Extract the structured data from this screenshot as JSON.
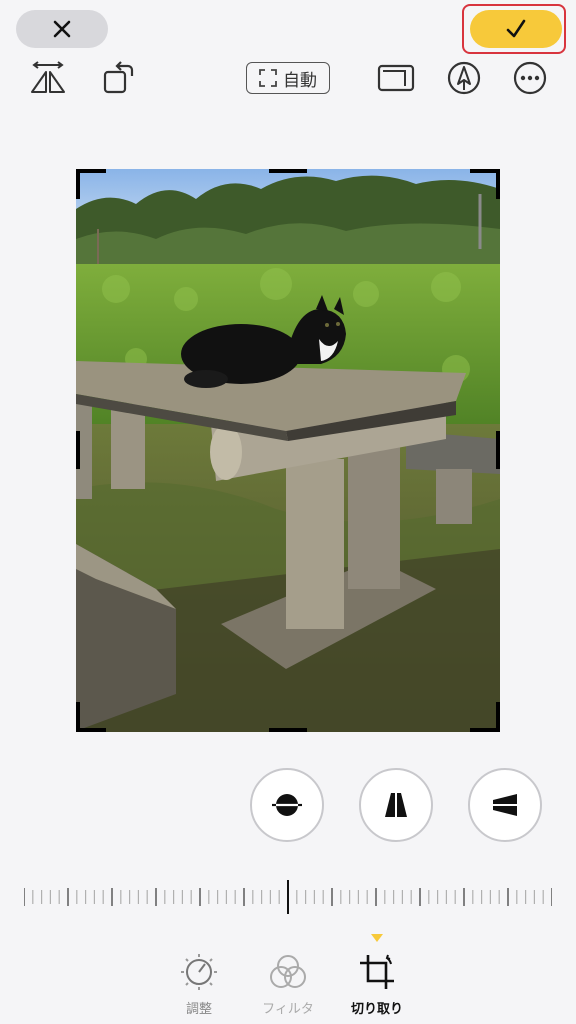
{
  "topbar": {
    "cancel_icon": "close-icon",
    "done_icon": "checkmark-icon",
    "auto_label": "自動"
  },
  "tools": {
    "flip": "flip-horizontal-icon",
    "rotate": "rotate-icon",
    "aspect": "aspect-ratio-icon",
    "markup": "markup-pen-icon",
    "more": "more-icon"
  },
  "adjust_tools": [
    "straighten-icon",
    "vertical-perspective-icon",
    "horizontal-perspective-icon"
  ],
  "tabs": [
    {
      "label": "調整",
      "icon": "adjust-dial-icon",
      "active": false
    },
    {
      "label": "フィルタ",
      "icon": "filters-icon",
      "active": false
    },
    {
      "label": "切り取り",
      "icon": "crop-icon",
      "active": true
    }
  ],
  "colors": {
    "accent": "#f7c93a",
    "highlight_border": "#d8343e",
    "background": "#f5f5f7"
  }
}
